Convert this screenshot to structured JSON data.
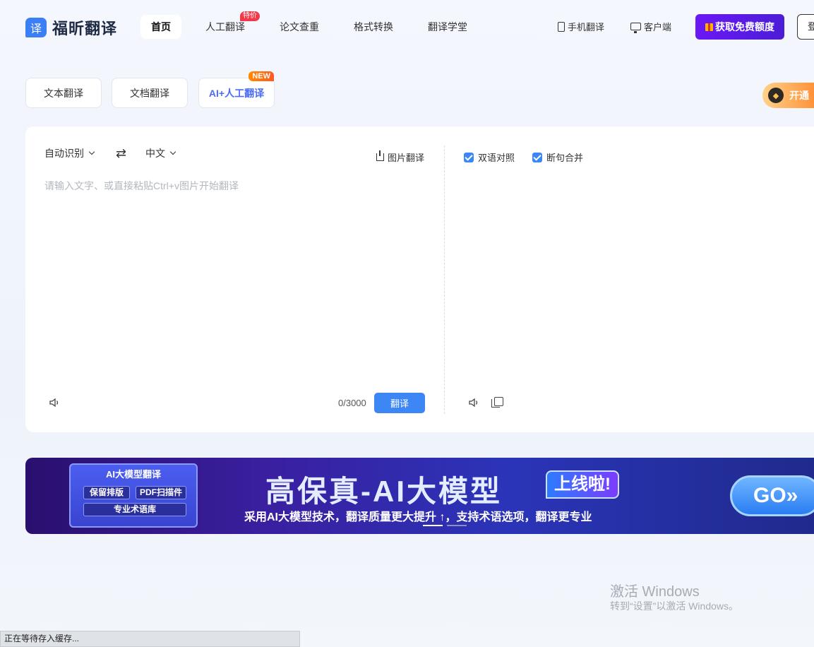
{
  "header": {
    "logo_glyph": "译",
    "logo_text": "福昕翻译",
    "nav": [
      {
        "label": "首页",
        "active": true
      },
      {
        "label": "人工翻译",
        "badge": "特价"
      },
      {
        "label": "论文查重"
      },
      {
        "label": "格式转换"
      },
      {
        "label": "翻译学堂"
      }
    ],
    "mobile_link": "手机翻译",
    "client_link": "客户端",
    "free_quota_button": "获取免费额度",
    "login_button": "登"
  },
  "mode_tabs": {
    "text": "文本翻译",
    "document": "文档翻译",
    "ai_human": "AI+人工翻译",
    "new_badge": "NEW",
    "vip_label": "开通"
  },
  "translator": {
    "source_lang": "自动识别",
    "target_lang": "中文",
    "image_translate": "图片翻译",
    "placeholder": "请输入文字、或直接粘贴Ctrl+v图片开始翻译",
    "char_count": "0/3000",
    "translate_button": "翻译",
    "bilingual_label": "双语对照",
    "bilingual_checked": true,
    "merge_label": "断句合并",
    "merge_checked": true
  },
  "banner": {
    "card_title": "AI大模型翻译",
    "chip1": "保留排版",
    "chip2": "PDF扫描件",
    "chip3": "专业术语库",
    "title": "高保真-AI大模型",
    "online": "上线啦!",
    "subtitle": "采用AI大模型技术，翻译质量更大提升 ↑，支持术语选项，翻译更专业",
    "go": "GO»"
  },
  "watermark": {
    "line1": "激活 Windows",
    "line2": "转到“设置”以激活 Windows。"
  },
  "status_bar": "正在等待存入缓存..."
}
